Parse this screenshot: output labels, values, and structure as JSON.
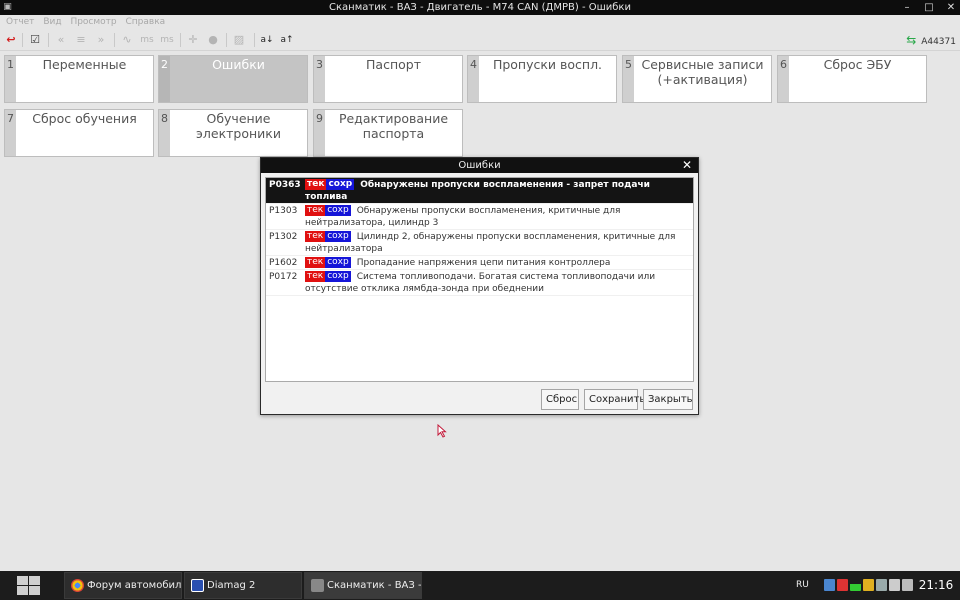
{
  "window": {
    "title": "Сканматик - ВАЗ - Двигатель - М74 CAN (ДМРВ) - Ошибки",
    "controls": [
      "–",
      "□",
      "✕"
    ]
  },
  "menu": [
    "Отчет",
    "Вид",
    "Просмотр",
    "Справка"
  ],
  "toolbar": {
    "text_buttons": [
      "ms",
      "ms",
      "a↓",
      "a↑"
    ],
    "adapter_label": "A44371"
  },
  "tiles": [
    {
      "num": "1",
      "label": "Переменные"
    },
    {
      "num": "2",
      "label": "Ошибки"
    },
    {
      "num": "3",
      "label": "Паспорт"
    },
    {
      "num": "4",
      "label": "Пропуски воспл."
    },
    {
      "num": "5",
      "label": "Сервисные записи (+активация)"
    },
    {
      "num": "6",
      "label": "Сброс ЭБУ"
    },
    {
      "num": "7",
      "label": "Сброс обучения"
    },
    {
      "num": "8",
      "label": "Обучение электроники"
    },
    {
      "num": "9",
      "label": "Редактирование паспорта"
    }
  ],
  "dialog": {
    "title": "Ошибки",
    "close_glyph": "✕",
    "badge_current": "тек",
    "badge_saved": "сохр",
    "errors": [
      {
        "code": "P0363",
        "text": "Обнаружены пропуски воспламенения - запрет подачи топлива"
      },
      {
        "code": "P1303",
        "text": "Обнаружены пропуски воспламенения, критичные для нейтрализатора, цилиндр 3"
      },
      {
        "code": "P1302",
        "text": "Цилиндр 2, обнаружены пропуски воспламенения, критичные для нейтрализатора"
      },
      {
        "code": "P1602",
        "text": "Пропадание напряжения цепи питания контроллера"
      },
      {
        "code": "P0172",
        "text": "Система топливоподачи. Богатая система топливоподачи или отсутствие отклика лямбда-зонда при обеднении"
      }
    ],
    "buttons": {
      "reset": "Сброс",
      "save": "Сохранить",
      "close": "Закрыть"
    }
  },
  "taskbar": {
    "tasks": [
      "Форум автомобил...",
      "Diamag 2",
      "Сканматик - ВАЗ -..."
    ],
    "language": "RU",
    "clock": "21:16"
  },
  "colors": {
    "badge_current": "#e01010",
    "badge_saved": "#1515d8",
    "selected_row": "#141414",
    "active_tile": "#c4c4c4"
  }
}
